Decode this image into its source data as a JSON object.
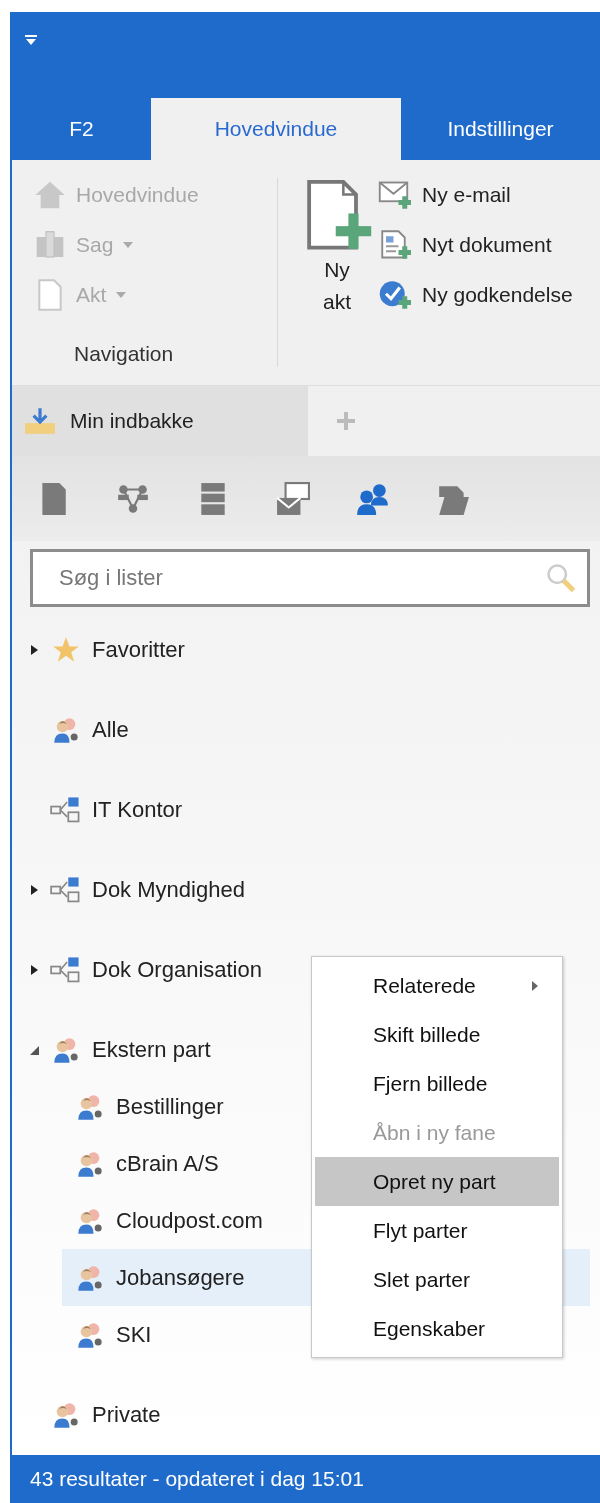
{
  "header": {
    "tabs": [
      {
        "label": "F2",
        "selected": false
      },
      {
        "label": "Hovedvindue",
        "selected": true
      },
      {
        "label": "Indstillinger",
        "selected": false
      }
    ]
  },
  "ribbon": {
    "navigation": {
      "label": "Navigation",
      "items": [
        {
          "label": "Hovedvindue",
          "disabled": true,
          "dropdown": false
        },
        {
          "label": "Sag",
          "disabled": true,
          "dropdown": true
        },
        {
          "label": "Akt",
          "disabled": true,
          "dropdown": true
        }
      ]
    },
    "new": {
      "big_button": {
        "label": "Ny akt"
      },
      "items": [
        {
          "label": "Ny e-mail"
        },
        {
          "label": "Nyt dokument"
        },
        {
          "label": "Ny godkendelse"
        }
      ]
    }
  },
  "panel_tabs": [
    {
      "label": "Min indbakke",
      "selected": true
    }
  ],
  "list_toolbar": [
    {
      "selected": false
    },
    {
      "selected": false
    },
    {
      "selected": false
    },
    {
      "selected": false
    },
    {
      "selected": true
    },
    {
      "selected": false
    }
  ],
  "search": {
    "placeholder": "Søg i lister"
  },
  "tree": [
    {
      "label": "Favoritter",
      "kind": "favorite",
      "expanded": false,
      "selected": false
    },
    {
      "label": "Alle",
      "kind": "group",
      "selected": false
    },
    {
      "label": "IT Kontor",
      "kind": "org",
      "selected": false
    },
    {
      "label": "Dok Myndighed",
      "kind": "org",
      "expanded": false,
      "selected": false
    },
    {
      "label": "Dok Organisation",
      "kind": "org",
      "expanded": false,
      "selected": false
    },
    {
      "label": "Ekstern part",
      "kind": "group",
      "expanded": true,
      "selected": false,
      "children": [
        {
          "label": "Bestillinger",
          "kind": "group",
          "selected": false
        },
        {
          "label": "cBrain A/S",
          "kind": "group",
          "selected": false
        },
        {
          "label": "Cloudpost.com",
          "kind": "group",
          "selected": false
        },
        {
          "label": "Jobansøgere",
          "kind": "group",
          "selected": true
        },
        {
          "label": "SKI",
          "kind": "group",
          "selected": false
        }
      ]
    },
    {
      "label": "Private",
      "kind": "group",
      "selected": false
    }
  ],
  "context_menu": [
    {
      "label": "Relaterede",
      "disabled": false,
      "selected": false,
      "submenu": true
    },
    {
      "label": "Skift billede",
      "disabled": false,
      "selected": false,
      "submenu": false
    },
    {
      "label": "Fjern billede",
      "disabled": false,
      "selected": false,
      "submenu": false
    },
    {
      "label": "Åbn i ny fane",
      "disabled": true,
      "selected": false,
      "submenu": false
    },
    {
      "label": "Opret ny part",
      "disabled": false,
      "selected": true,
      "submenu": false
    },
    {
      "label": "Flyt parter",
      "disabled": false,
      "selected": false,
      "submenu": false
    },
    {
      "label": "Slet parter",
      "disabled": false,
      "selected": false,
      "submenu": false
    },
    {
      "label": "Egenskaber",
      "disabled": false,
      "selected": false,
      "submenu": false
    }
  ],
  "status_bar": {
    "text": "43 resultater - opdateret i dag 15:01"
  }
}
